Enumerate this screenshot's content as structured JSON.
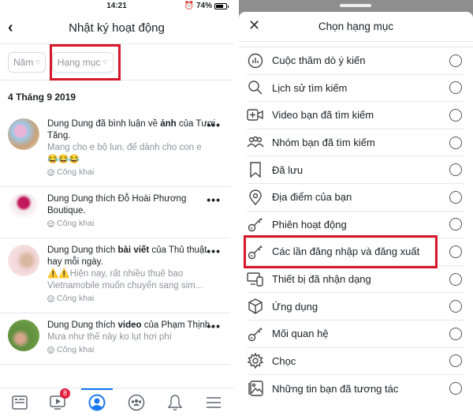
{
  "left": {
    "status_bar": {
      "time": "14:21",
      "battery": "74%",
      "battery_level": 0.74
    },
    "header": {
      "title": "Nhật ký hoạt động"
    },
    "filters": [
      {
        "label": "Năm"
      },
      {
        "label": "Hạng mục",
        "highlighted": true
      }
    ],
    "date_heading": "4 Tháng 9 2019",
    "entries": [
      {
        "title_pre": "Dung Dung đã bình luận về ",
        "title_bold": "ảnh",
        "title_post": " của Tươi Tăng.",
        "preview": "Mang cho e bộ lun, để dành cho con e",
        "emoji": "😂😂😂",
        "privacy": "Công khai"
      },
      {
        "title_pre": "Dung Dung thích Đỗ Hoài Phương Boutique.",
        "title_bold": "",
        "title_post": "",
        "preview": "",
        "emoji": "",
        "privacy": "Công khai"
      },
      {
        "title_pre": "Dung Dung thích ",
        "title_bold": "bài viết",
        "title_post": " của Thủ thuật hay mỗi ngày.",
        "preview": "⚠️⚠️Hiện nay, rất nhiều thuê bao Vietnamobile muốn chuyển sang sim...",
        "emoji": "",
        "privacy": "Công khai"
      },
      {
        "title_pre": "Dung Dung thích ",
        "title_bold": "video",
        "title_post": " của Phạm Thịnh.",
        "preview": "Mưa như thế này ko lụt hơi phí",
        "emoji": "",
        "privacy": "Công khai"
      }
    ],
    "tabbar": {
      "tabs": [
        {
          "icon": "news-feed-icon"
        },
        {
          "icon": "watch-icon",
          "badge": "8"
        },
        {
          "icon": "profile-icon",
          "active": true
        },
        {
          "icon": "groups-icon"
        },
        {
          "icon": "bell-icon"
        },
        {
          "icon": "menu-icon"
        }
      ]
    },
    "more_label": "•••"
  },
  "right": {
    "sheet_title": "Chọn hạng mục",
    "close_label": "✕",
    "categories": [
      {
        "label": "Cuộc thăm dò ý kiến",
        "icon": "poll-icon"
      },
      {
        "label": "Lịch sử tìm kiếm",
        "icon": "search-icon"
      },
      {
        "label": "Video bạn đã tìm kiếm",
        "icon": "video-add-icon"
      },
      {
        "label": "Nhóm bạn đã tìm kiếm",
        "icon": "group-icon"
      },
      {
        "label": "Đã lưu",
        "icon": "bookmark-icon"
      },
      {
        "label": "Địa điểm của bạn",
        "icon": "location-pin-icon"
      },
      {
        "label": "Phiên hoạt động",
        "icon": "key-icon"
      },
      {
        "label": "Các lần đăng nhập và đăng xuất",
        "icon": "key-icon",
        "highlighted": true
      },
      {
        "label": "Thiết bị đã nhận dạng",
        "icon": "devices-icon"
      },
      {
        "label": "Ứng dụng",
        "icon": "cube-icon"
      },
      {
        "label": "Mối quan hệ",
        "icon": "key-icon"
      },
      {
        "label": "Chọc",
        "icon": "gear-icon"
      },
      {
        "label": "Những tin bạn đã tương tác",
        "icon": "story-image-icon"
      }
    ]
  },
  "colors": {
    "highlight": "#d7162a",
    "accent": "#1877f2",
    "badge": "#e41e3f"
  }
}
